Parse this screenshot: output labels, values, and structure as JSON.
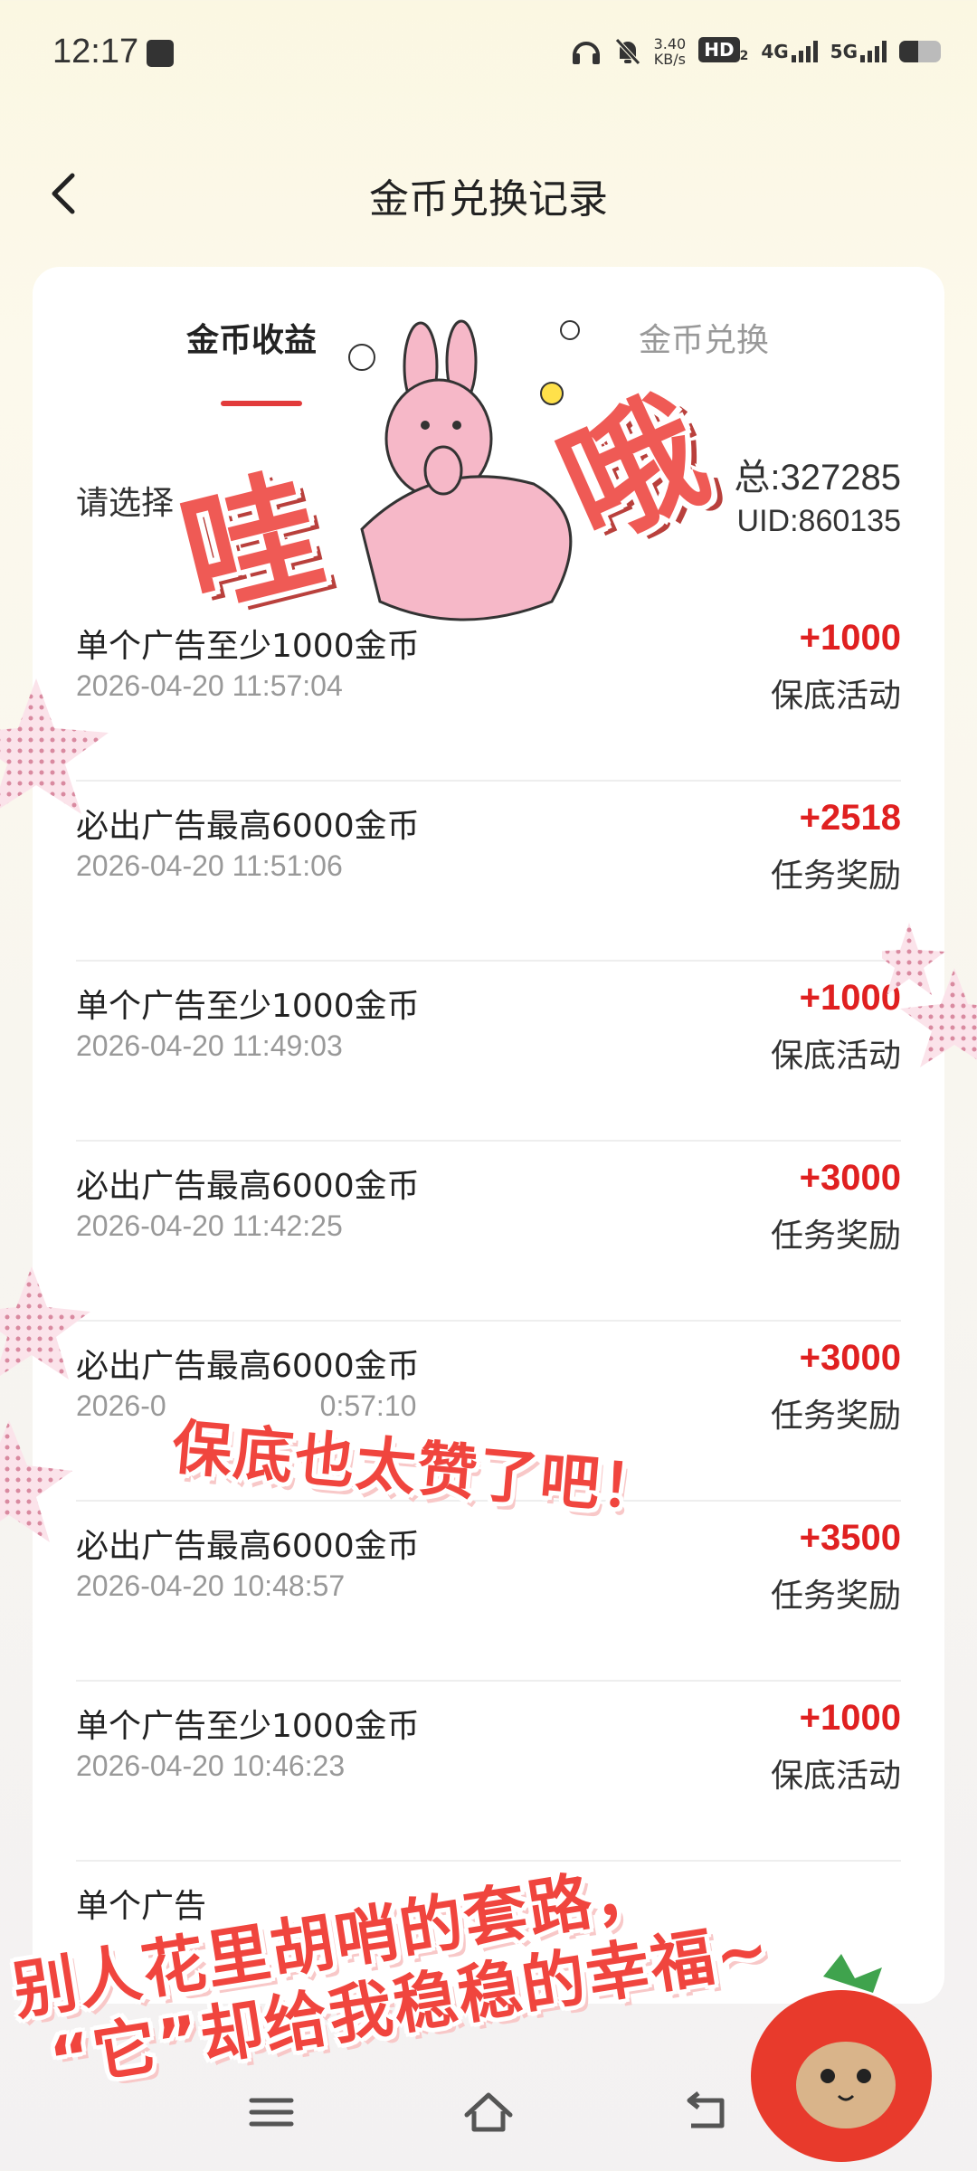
{
  "status_bar": {
    "time": "12:17",
    "net_speed_value": "3.40",
    "net_speed_unit": "KB/s",
    "hd_badge": "HD",
    "hd_sub": "2",
    "signal_1": "4G",
    "signal_2": "5G",
    "battery_level": 0.45,
    "icons": [
      "sim-card-icon",
      "headphones-icon",
      "mute-bell-icon",
      "battery-icon"
    ]
  },
  "header": {
    "title": "金币兑换记录",
    "back_icon": "chevron-left-icon"
  },
  "tabs": [
    {
      "label": "金币收益",
      "active": true
    },
    {
      "label": "金币兑换",
      "active": false
    }
  ],
  "summary": {
    "filter_label": "请选择",
    "total": "总:327285",
    "uid": "UID:860135"
  },
  "records": [
    {
      "title": "单个广告至少1000金币",
      "time": "2026-04-20 11:57:04",
      "amount": "+1000",
      "type": "保底活动"
    },
    {
      "title": "必出广告最高6000金币",
      "time": "2026-04-20 11:51:06",
      "amount": "+2518",
      "type": "任务奖励"
    },
    {
      "title": "单个广告至少1000金币",
      "time": "2026-04-20 11:49:03",
      "amount": "+1000",
      "type": "保底活动"
    },
    {
      "title": "必出广告最高6000金币",
      "time": "2026-04-20 11:42:25",
      "amount": "+3000",
      "type": "任务奖励"
    },
    {
      "title": "必出广告最高6000金币",
      "time": "2026-0",
      "time_tail": "0:57:10",
      "amount": "+3000",
      "type": "任务奖励"
    },
    {
      "title": "必出广告最高6000金币",
      "time": "2026-04-20 10:48:57",
      "amount": "+3500",
      "type": "任务奖励"
    },
    {
      "title": "单个广告至少1000金币",
      "time": "2026-04-20 10:46:23",
      "amount": "+1000",
      "type": "保底活动"
    },
    {
      "title": "单个广告",
      "time": "",
      "amount": "",
      "type": ""
    }
  ],
  "overlays": {
    "wow_left": "哇",
    "wow_right": "哦",
    "caption_middle": "保底也太赞了吧！",
    "caption_bottom_1": "别人花里胡哨的套路，",
    "caption_bottom_2": "“它”却给我稳稳的幸福~",
    "stickers": [
      "rabbit-sticker",
      "tomato-cat-sticker",
      "star-decoration"
    ]
  },
  "navbar": {
    "icons": [
      "menu-icon",
      "home-icon",
      "back-icon"
    ]
  },
  "colors": {
    "accent": "#e02020",
    "tab_indicator": "#e23b3b",
    "caption_red": "#f0453e"
  }
}
